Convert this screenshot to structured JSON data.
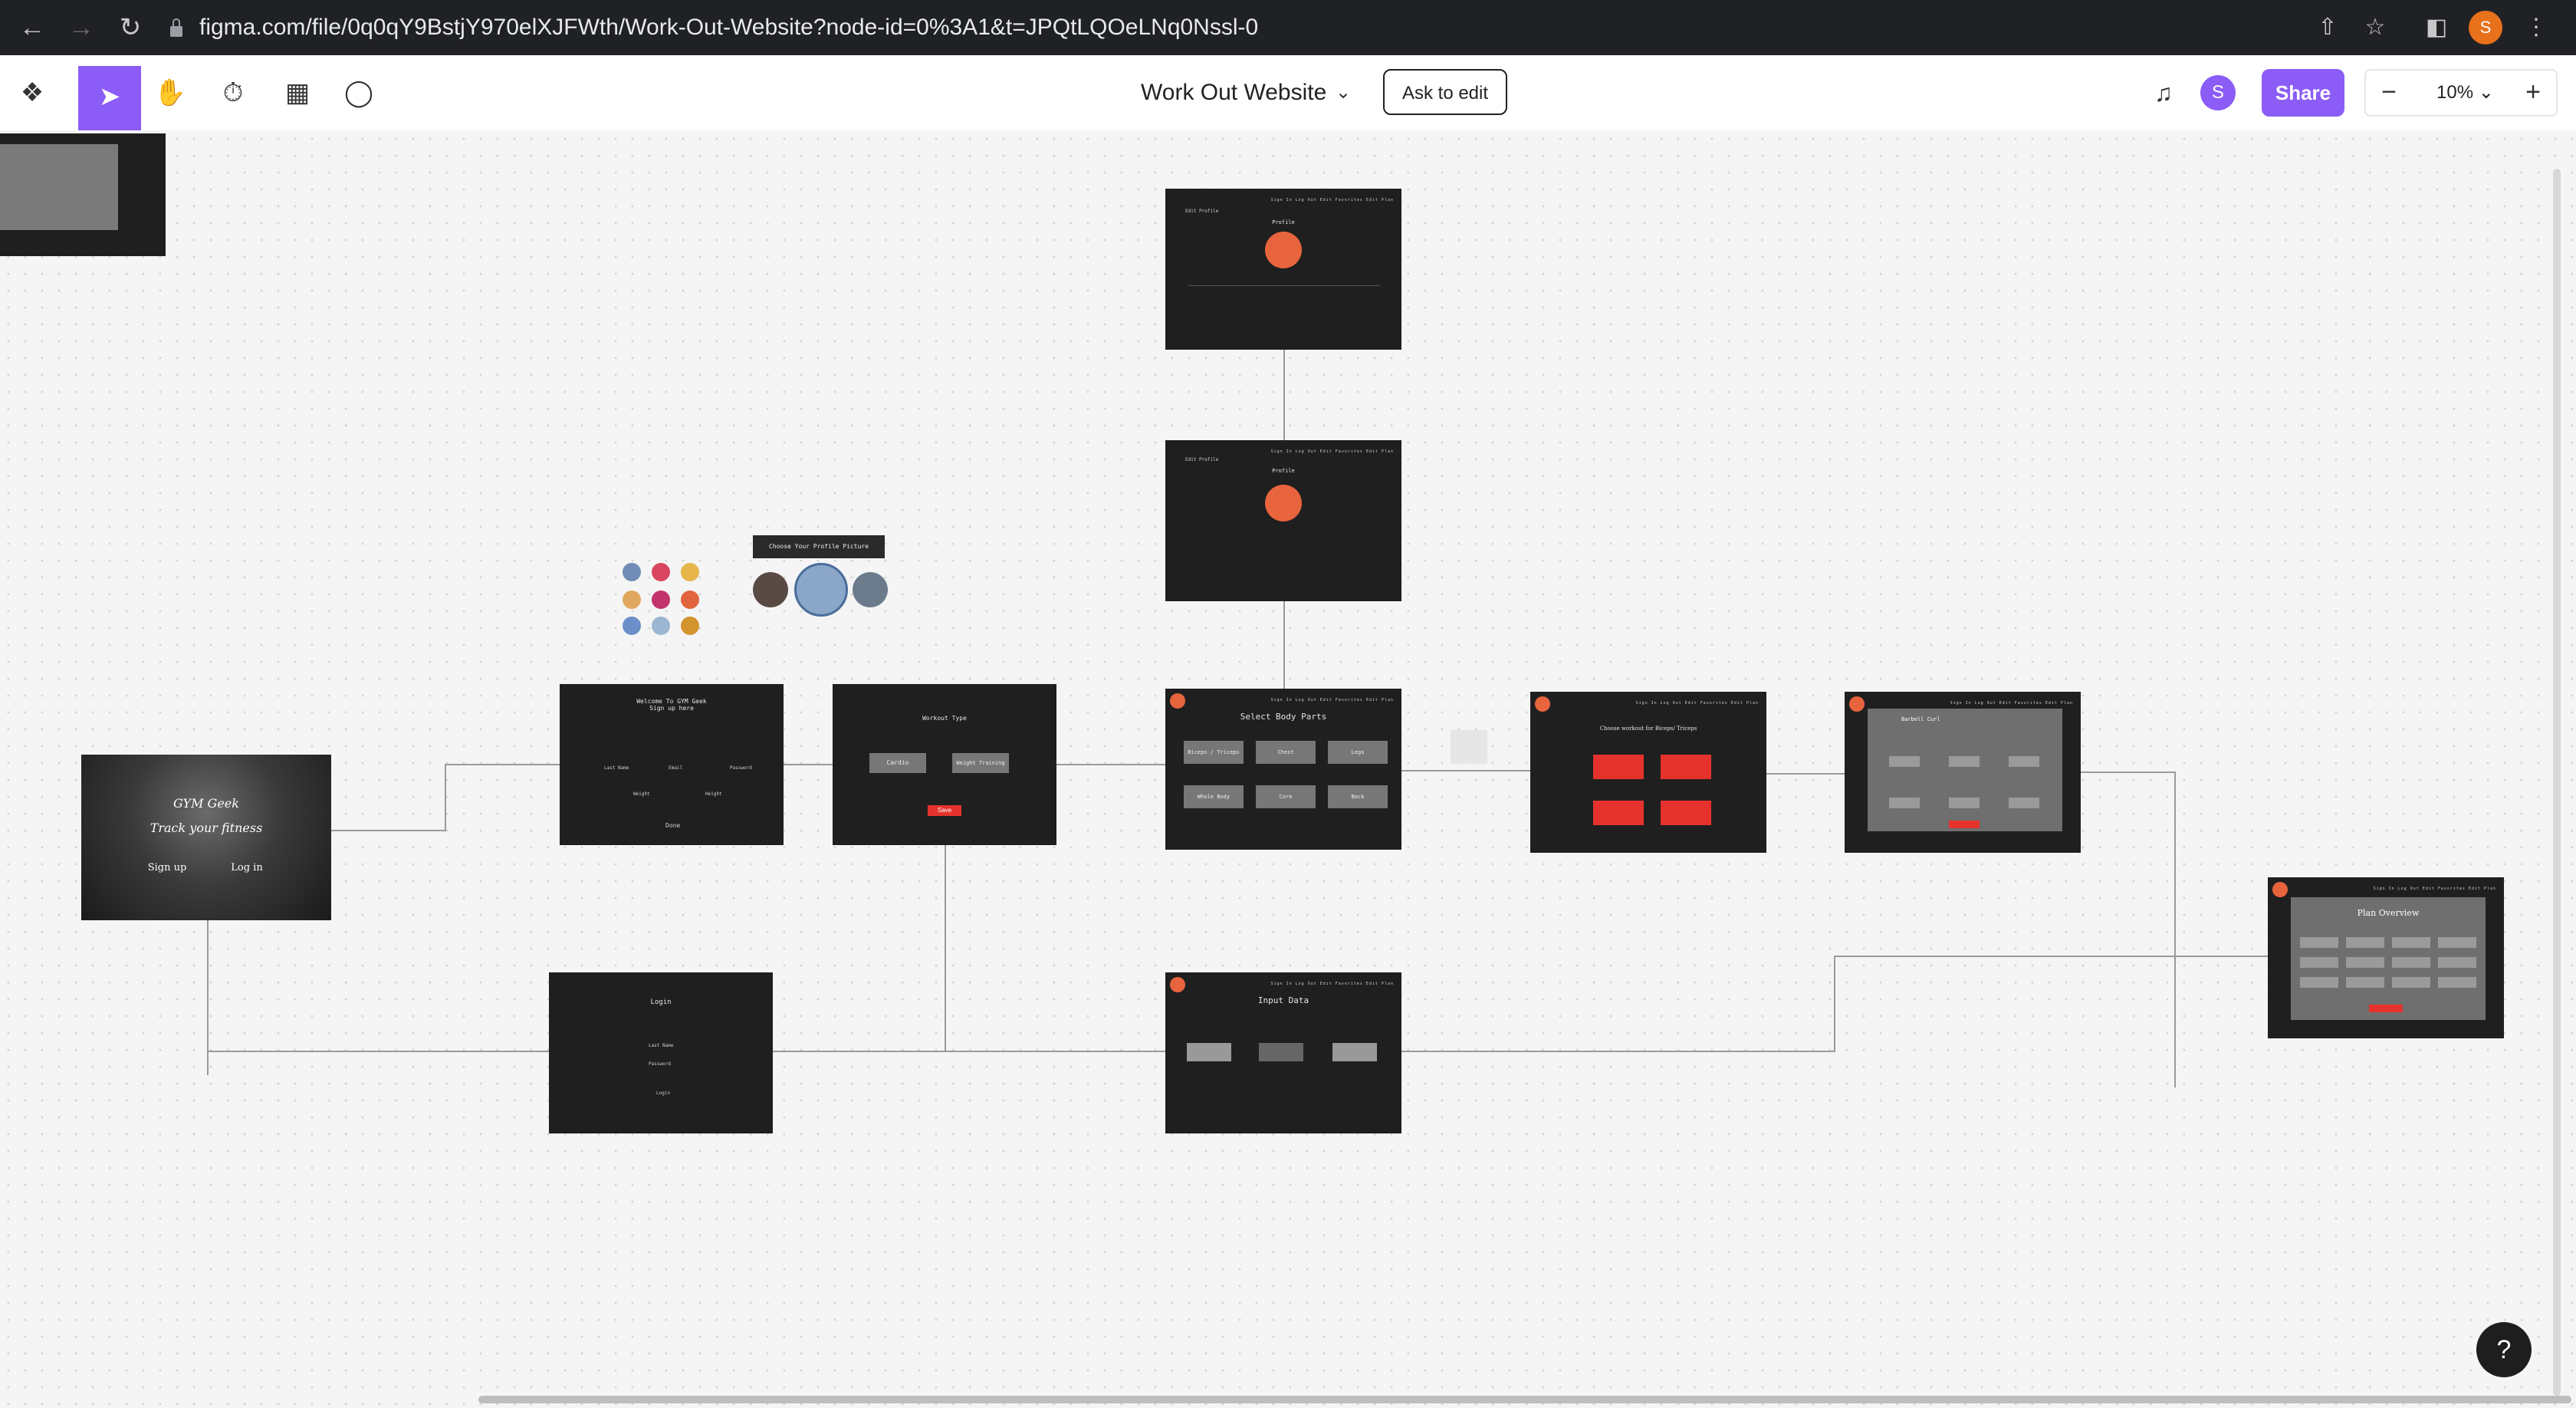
{
  "browser": {
    "url": "figma.com/file/0q0qY9BstjY970elXJFWth/Work-Out-Website?node-id=0%3A1&t=JPQtLQOeLNq0Nssl-0",
    "profile_initial": "S"
  },
  "toolbar": {
    "file_title": "Work Out Website",
    "ask_to_edit": "Ask to edit",
    "user_initial": "S",
    "share": "Share",
    "zoom": "10%"
  },
  "frames": {
    "landing": {
      "line1": "GYM Geek",
      "line2": "Track your fitness",
      "signup": "Sign up",
      "login": "Log in"
    },
    "signup": {
      "title": "Welcome To GYM Geek\nSign up here",
      "fields": [
        "Last Name",
        "Email",
        "Password",
        "Weight",
        "Height"
      ],
      "submit": "Done"
    },
    "login": {
      "title": "Login",
      "fields": [
        "Last Name",
        "Password"
      ],
      "submit": "Login"
    },
    "workout_type": {
      "title": "Workout Type",
      "cardio": "Cardio",
      "weight": "Weight Training",
      "save": "Save"
    },
    "profile_picture": {
      "title": "Choose Your Profile Picture"
    },
    "profile1": {
      "title": "Profile",
      "edit": "Edit Profile"
    },
    "profile2": {
      "title": "Profile",
      "edit": "Edit Profile"
    },
    "select_body": {
      "title": "Select Body Parts",
      "parts": [
        "Biceps / Triceps",
        "Chest",
        "Legs",
        "Whole Body",
        "Core",
        "Back"
      ]
    },
    "choose_workout": {
      "title": "Choose workout for Biceps/ Triceps"
    },
    "barbell": {
      "title": "Barbell Curl"
    },
    "input_data": {
      "title": "Input Data"
    },
    "plan_overview": {
      "title": "Plan Overview"
    }
  },
  "nav_items": "Sign In   Log Out   Edit Favorites   Edit Plan",
  "colors": {
    "accent": "#8b5cf6",
    "frame_bg": "#1f1f1f",
    "red": "#e5322d"
  }
}
